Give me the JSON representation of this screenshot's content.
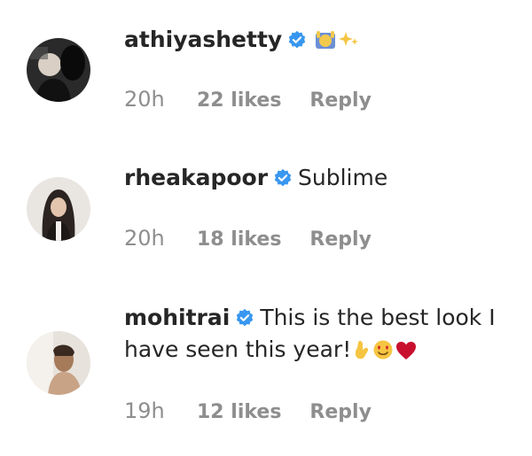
{
  "comments": [
    {
      "username": "athiyashetty",
      "text": "",
      "emojis": [
        "raised-hands-emoji",
        "sparkle-emoji"
      ],
      "time": "20h",
      "likes": "22 likes",
      "reply": "Reply"
    },
    {
      "username": "rheakapoor",
      "text": "Sublime",
      "emojis": [],
      "time": "20h",
      "likes": "18 likes",
      "reply": "Reply"
    },
    {
      "username": "mohitrai",
      "text": "This is the best look I have seen this year!",
      "emojis": [
        "ok-hand-emoji",
        "heart-eyes-emoji",
        "red-heart-emoji"
      ],
      "time": "19h",
      "likes": "12 likes",
      "reply": "Reply"
    }
  ],
  "colors": {
    "verified_badge": "#3897f0",
    "meta_text": "#8e8e8e",
    "body_text": "#262626"
  }
}
